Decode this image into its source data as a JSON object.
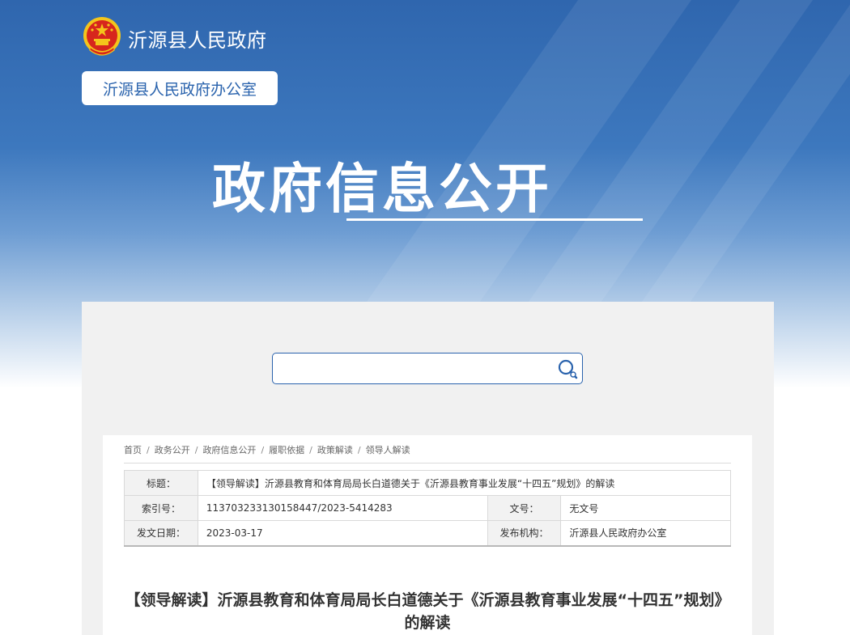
{
  "header": {
    "site_name": "沂源县人民政府",
    "office_label": "沂源县人民政府办公室",
    "hero_title": "政府信息公开"
  },
  "search": {
    "value": "",
    "placeholder": "",
    "icon": "search-icon"
  },
  "breadcrumb": [
    {
      "label": "首页"
    },
    {
      "label": "政务公开"
    },
    {
      "label": "政府信息公开"
    },
    {
      "label": "履职依据"
    },
    {
      "label": "政策解读"
    },
    {
      "label": "领导人解读"
    }
  ],
  "meta": {
    "title_label": "标题：",
    "title_value": "【领导解读】沂源县教育和体育局局长白道德关于《沂源县教育事业发展“十四五”规划》的解读",
    "index_label": "索引号：",
    "index_value": "113703233130158447/2023-5414283",
    "docno_label": "文号：",
    "docno_value": "无文号",
    "date_label": "发文日期：",
    "date_value": "2023-03-17",
    "org_label": "发布机构：",
    "org_value": "沂源县人民政府办公室"
  },
  "article": {
    "title": "【领导解读】沂源县教育和体育局局长白道德关于《沂源县教育事业发展“十四五”规划》的解读"
  },
  "colors": {
    "brand_blue": "#2a63ad",
    "emblem_red": "#d7261d",
    "emblem_gold": "#f4c51b"
  }
}
